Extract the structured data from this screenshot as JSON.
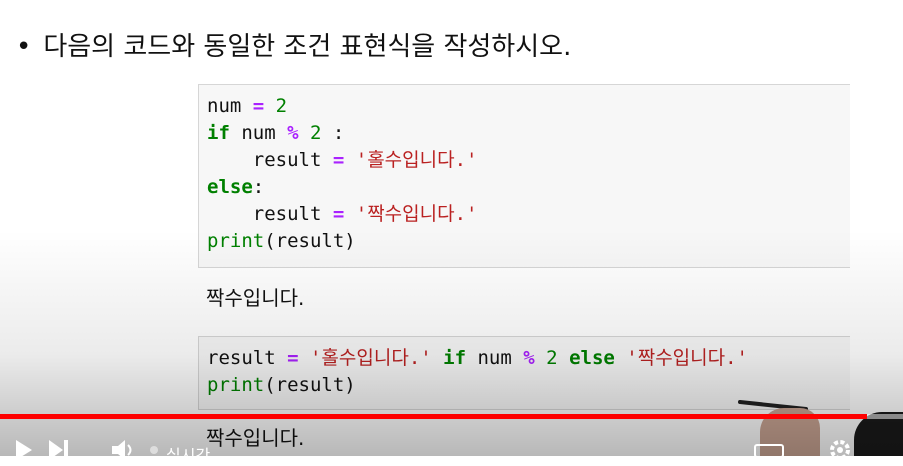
{
  "instruction": {
    "bullet": "•",
    "text": "다음의 코드와 동일한 조건 표현식을 작성하시오."
  },
  "cell1": {
    "line1": {
      "a": "num ",
      "op": "=",
      "b": " ",
      "num": "2"
    },
    "line2": {
      "kw": "if",
      "a": " num ",
      "op": "%",
      "b": " ",
      "num": "2",
      "c": " :"
    },
    "line3": {
      "indent": "    ",
      "a": "result ",
      "op": "=",
      "b": " ",
      "str": "'홀수입니다.'"
    },
    "line4": {
      "kw": "else",
      "c": ":"
    },
    "line5": {
      "indent": "    ",
      "a": "result ",
      "op": "=",
      "b": " ",
      "str": "'짝수입니다.'"
    },
    "line6": {
      "fn": "print",
      "args": "(result)"
    }
  },
  "output1": "짝수입니다.",
  "cell2": {
    "line1": {
      "a": "result ",
      "op": "=",
      "b": " ",
      "str1": "'홀수입니다.'",
      "c": " ",
      "kw1": "if",
      "d": " num ",
      "op2": "%",
      "e": " ",
      "num": "2",
      "f": " ",
      "kw2": "else",
      "g": " ",
      "str2": "'짝수입니다.'"
    },
    "line2": {
      "fn": "print",
      "args": "(result)"
    }
  },
  "output2": "짝수입니다.",
  "player": {
    "progress_percent": 96,
    "live_label": "실시간",
    "colors": {
      "progress": "#ff0000"
    },
    "icons": [
      "play-icon",
      "next-icon",
      "volume-icon",
      "live-dot-icon",
      "subtitles-icon",
      "settings-icon"
    ]
  }
}
